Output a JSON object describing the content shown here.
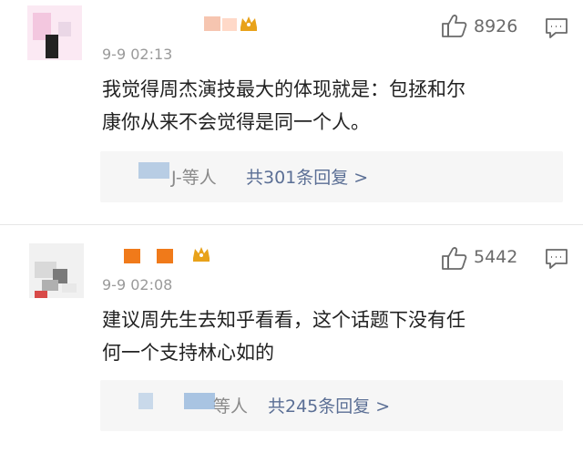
{
  "comments": [
    {
      "time": "9-9 02:13",
      "likes": "8926",
      "text_lines": [
        "我觉得周杰演技最大的体现就是：包拯和尔",
        "康你从来不会觉得是同一个人。"
      ],
      "reply_prefix": "J-等人",
      "reply_count_text": "共301条回复 >"
    },
    {
      "time": "9-9 02:08",
      "likes": "5442",
      "text_lines": [
        "建议周先生去知乎看看，这个话题下没有任",
        "何一个支持林心如的"
      ],
      "reply_prefix": "等人",
      "reply_count_text": "共245条回复 >"
    }
  ],
  "icons": {
    "like": "thumbs-up-icon",
    "reply": "comment-bubble-icon",
    "badge": "crown-badge-icon"
  },
  "colors": {
    "link": "#5b6f95",
    "muted": "#9a9a9a",
    "reply_bg": "#f6f6f6",
    "crown": "#e8a21a",
    "orange_block": "#f07a1a"
  }
}
